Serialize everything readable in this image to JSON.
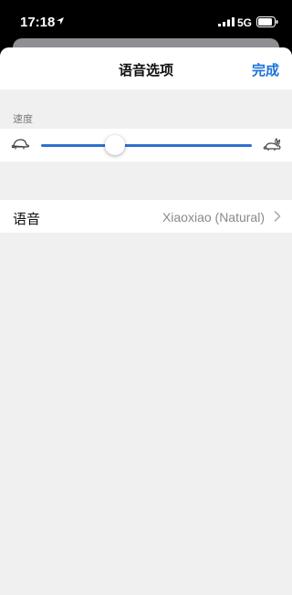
{
  "status_bar": {
    "time": "17:18",
    "network": "5G"
  },
  "header": {
    "title": "语音选项",
    "done_label": "完成"
  },
  "speed": {
    "label": "速度",
    "level": 0.35,
    "slow_icon": "turtle-icon",
    "fast_icon": "rabbit-icon"
  },
  "voice": {
    "label": "语音",
    "value": "Xiaoxiao (Natural)"
  },
  "colors": {
    "accent": "#1a73d9",
    "slider": "#2f6fd1",
    "background": "#f0f0f0"
  }
}
